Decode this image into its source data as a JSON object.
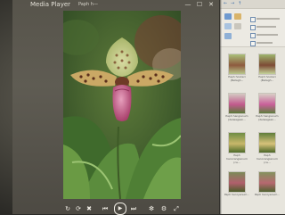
{
  "media_player": {
    "app_title": "Media Player",
    "file_title": "Paph h—",
    "window_controls": {
      "minimize_glyph": "—",
      "restore_glyph": "☐",
      "close_glyph": "✕"
    },
    "photo_subject": "Paphiopedilum slipper orchid",
    "playback_controls": [
      {
        "name": "rotate-icon",
        "glyph": "↻"
      },
      {
        "name": "loop-icon",
        "glyph": "⟳"
      },
      {
        "name": "shuffle-icon",
        "glyph": "✖"
      },
      {
        "name": "previous-icon",
        "glyph": "⏮"
      },
      {
        "name": "play-icon",
        "glyph": "▶"
      },
      {
        "name": "next-icon",
        "glyph": "⏭"
      },
      {
        "name": "volume-icon",
        "glyph": "❇"
      },
      {
        "name": "settings-icon",
        "glyph": "⚙"
      },
      {
        "name": "zoom-icon",
        "glyph": "⤢"
      }
    ]
  },
  "file_explorer": {
    "toolbar": [
      "←",
      "→",
      "↑"
    ],
    "thumbnails": [
      {
        "caption": "Paph hookeri (Betagh...",
        "colors": [
          "#a9c07a",
          "#8d5a3e",
          "#b9c88d"
        ]
      },
      {
        "caption": "Paph hookeri (Betagh...",
        "colors": [
          "#9db46d",
          "#7d4b35",
          "#c4d39a"
        ]
      },
      {
        "caption": "Paph hangianum (delwagsen...",
        "colors": [
          "#d4c9c2",
          "#c25a8e",
          "#5a7a3a"
        ]
      },
      {
        "caption": "Paph hangianum (delwagsen...",
        "colors": [
          "#d9cfc6",
          "#c9609a",
          "#5e7e3e"
        ]
      },
      {
        "caption": "Paph hanorangianum (ca...",
        "colors": [
          "#6f8d44",
          "#c8b76a",
          "#4d6b2a"
        ]
      },
      {
        "caption": "Paph hanorangianum (ca...",
        "colors": [
          "#5f7d3a",
          "#d7c27a",
          "#4a6628"
        ]
      },
      {
        "caption": "Paph henryanum...",
        "colors": [
          "#7c8a58",
          "#b05f6c",
          "#4c5e2a"
        ]
      },
      {
        "caption": "Paph henryanum...",
        "colors": [
          "#84925e",
          "#b66870",
          "#506330"
        ]
      }
    ]
  }
}
